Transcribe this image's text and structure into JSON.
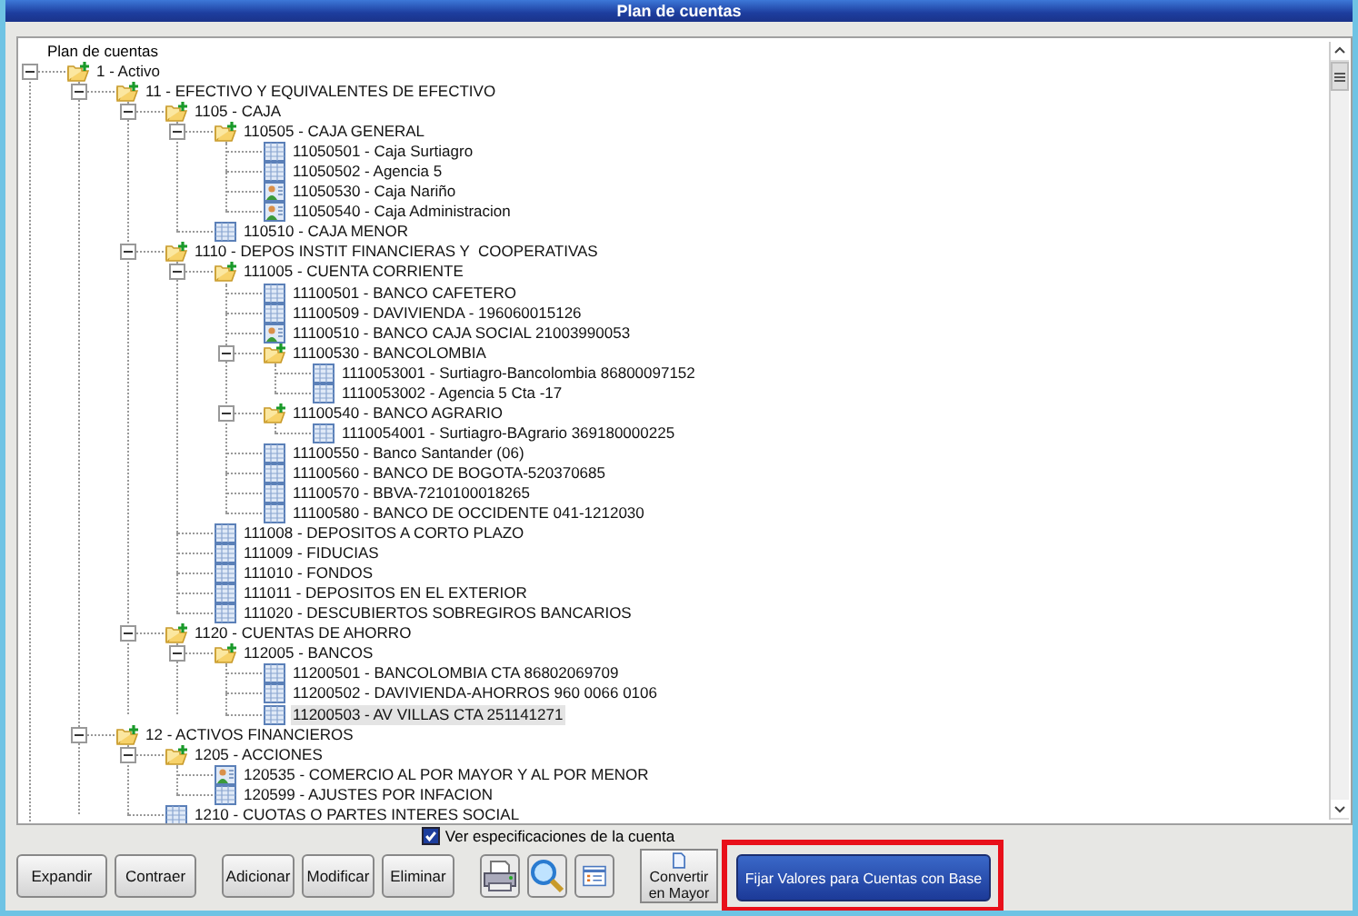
{
  "window": {
    "title": "Plan de cuentas"
  },
  "tree": {
    "root_label": "Plan de cuentas",
    "nodes": [
      {
        "label": "1 - Activo",
        "kind": "folder",
        "expanded": true,
        "selected": false,
        "children": [
          {
            "label": "11 - EFECTIVO Y EQUIVALENTES DE EFECTIVO",
            "kind": "folder",
            "expanded": true,
            "selected": false,
            "children": [
              {
                "label": "1105 - CAJA",
                "kind": "folder",
                "expanded": true,
                "selected": false,
                "children": [
                  {
                    "label": "110505 - CAJA GENERAL",
                    "kind": "folder",
                    "expanded": true,
                    "selected": false,
                    "children": [
                      {
                        "label": "11050501 - Caja Surtiagro",
                        "kind": "account",
                        "selected": false
                      },
                      {
                        "label": "11050502 - Agencia 5",
                        "kind": "account",
                        "selected": false
                      },
                      {
                        "label": "11050530 - Caja Nariño",
                        "kind": "person_account",
                        "selected": false
                      },
                      {
                        "label": "11050540 - Caja Administracion",
                        "kind": "person_account",
                        "selected": false
                      }
                    ]
                  },
                  {
                    "label": "110510 - CAJA MENOR",
                    "kind": "account",
                    "selected": false
                  }
                ]
              },
              {
                "label": "1110 - DEPOS INSTIT FINANCIERAS Y  COOPERATIVAS",
                "kind": "folder",
                "expanded": true,
                "selected": false,
                "children": [
                  {
                    "label": "111005 - CUENTA CORRIENTE",
                    "kind": "folder",
                    "expanded": true,
                    "selected": false,
                    "children": [
                      {
                        "label": "11100501 - BANCO CAFETERO",
                        "kind": "account",
                        "selected": false
                      },
                      {
                        "label": "11100509 - DAVIVIENDA - 196060015126",
                        "kind": "account",
                        "selected": false
                      },
                      {
                        "label": "11100510 - BANCO CAJA SOCIAL 21003990053",
                        "kind": "person_account",
                        "selected": false
                      },
                      {
                        "label": "11100530 - BANCOLOMBIA",
                        "kind": "folder",
                        "expanded": true,
                        "selected": false,
                        "children": [
                          {
                            "label": "1110053001 - Surtiagro-Bancolombia 86800097152",
                            "kind": "account",
                            "selected": false
                          },
                          {
                            "label": "1110053002 - Agencia 5 Cta -17",
                            "kind": "account",
                            "selected": false
                          }
                        ]
                      },
                      {
                        "label": "11100540 - BANCO AGRARIO",
                        "kind": "folder",
                        "expanded": true,
                        "selected": false,
                        "children": [
                          {
                            "label": "1110054001 - Surtiagro-BAgrario 369180000225",
                            "kind": "account",
                            "selected": false
                          }
                        ]
                      },
                      {
                        "label": "11100550 - Banco Santander (06)",
                        "kind": "account",
                        "selected": false
                      },
                      {
                        "label": "11100560 - BANCO DE BOGOTA-520370685",
                        "kind": "account",
                        "selected": false
                      },
                      {
                        "label": "11100570 - BBVA-7210100018265",
                        "kind": "account",
                        "selected": false
                      },
                      {
                        "label": "11100580 - BANCO DE OCCIDENTE 041-1212030",
                        "kind": "account",
                        "selected": false
                      }
                    ]
                  },
                  {
                    "label": "111008 - DEPOSITOS A CORTO PLAZO",
                    "kind": "account",
                    "selected": false
                  },
                  {
                    "label": "111009 - FIDUCIAS",
                    "kind": "account",
                    "selected": false
                  },
                  {
                    "label": "111010 - FONDOS",
                    "kind": "account",
                    "selected": false
                  },
                  {
                    "label": "111011 - DEPOSITOS EN EL EXTERIOR",
                    "kind": "account",
                    "selected": false
                  },
                  {
                    "label": "111020 - DESCUBIERTOS SOBREGIROS BANCARIOS",
                    "kind": "account",
                    "selected": false
                  }
                ]
              },
              {
                "label": "1120 - CUENTAS DE AHORRO",
                "kind": "folder",
                "expanded": true,
                "selected": false,
                "children": [
                  {
                    "label": "112005 - BANCOS",
                    "kind": "folder",
                    "expanded": true,
                    "selected": false,
                    "children": [
                      {
                        "label": "11200501 - BANCOLOMBIA CTA 86802069709",
                        "kind": "account",
                        "selected": false
                      },
                      {
                        "label": "11200502 - DAVIVIENDA-AHORROS 960 0066 0106",
                        "kind": "account",
                        "selected": false
                      },
                      {
                        "label": "11200503 - AV VILLAS CTA 251141271",
                        "kind": "account",
                        "selected": true
                      }
                    ]
                  }
                ]
              }
            ]
          },
          {
            "label": "12 - ACTIVOS FINANCIEROS",
            "kind": "folder",
            "expanded": true,
            "selected": false,
            "children": [
              {
                "label": "1205 - ACCIONES",
                "kind": "folder",
                "expanded": true,
                "selected": false,
                "children": [
                  {
                    "label": "120535 - COMERCIO AL POR MAYOR Y AL POR MENOR",
                    "kind": "person_account",
                    "selected": false
                  },
                  {
                    "label": "120599 - AJUSTES POR INFACION",
                    "kind": "account",
                    "selected": false
                  }
                ]
              },
              {
                "label": "1210 - CUOTAS O PARTES INTERES SOCIAL",
                "kind": "account",
                "selected": false
              }
            ]
          }
        ]
      }
    ]
  },
  "show_details": {
    "label": "Ver especificaciones de la cuenta",
    "checked": true
  },
  "buttons": {
    "expand": "Expandir",
    "collapse": "Contraer",
    "add": "Adicionar",
    "edit": "Modificar",
    "delete": "Eliminar",
    "convert": "Convertir en Mayor",
    "set_values": "Fijar Valores para Cuentas con Base"
  }
}
